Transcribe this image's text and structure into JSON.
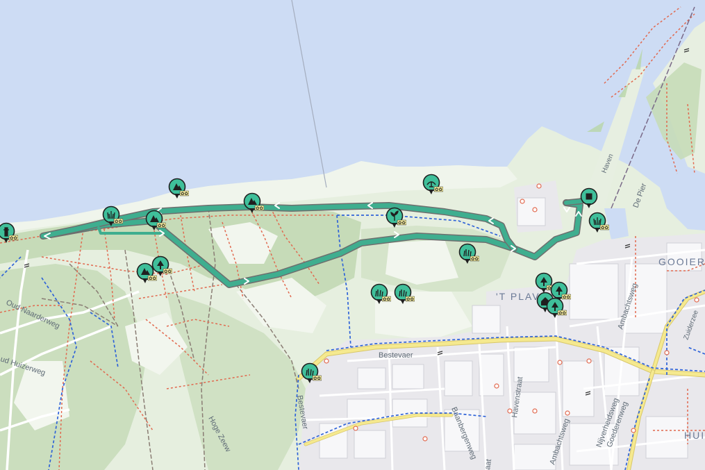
{
  "map": {
    "colors": {
      "water": "#cddcf4",
      "forest": "#c9dcbc",
      "grass": "#e6f0df",
      "urban": "#e7e7ea",
      "route": "#3fae8f",
      "route_outline": "#6e6e6e",
      "footpath": "#e1694f",
      "cycle_path": "#2f63d8",
      "main_road": "#f3e38b",
      "poi": "#3fbf9a"
    },
    "labels": {
      "oud_naarderweg": "Oud Naarderweg",
      "oud_huizerweg": "ud Huizerweg",
      "hoge_zeeweg": "Hoge Zeew",
      "bestevaer_top": "Bestevaer",
      "bestevaer_side": "Bestevaer",
      "baanbergenweg": "Baanbergenweg",
      "havenstraat": "Havenstraat",
      "ambachtsweg_a": "Ambachtsweg",
      "ambachtsweg_b": "Ambachtsweg",
      "nijverheidsweg": "Nijverheidsweg",
      "goederenweg": "Goederenweg",
      "de_pier": "De Pier",
      "haven": "Haven",
      "zuiderzee": "Zuiderzee",
      "oud_haven": "aat",
      "place_plaveen": "'T PLAV",
      "place_gooierhaven": "GOOIERH",
      "place_hui": "HUI"
    },
    "pois": [
      {
        "name": "forest-poi",
        "icon": "trees"
      },
      {
        "name": "forest-poi",
        "icon": "trees"
      },
      {
        "name": "marsh-poi",
        "icon": "reed"
      },
      {
        "name": "forest-poi",
        "icon": "trees"
      },
      {
        "name": "forest-poi",
        "icon": "trees"
      },
      {
        "name": "forest-poi",
        "icon": "trees"
      },
      {
        "name": "bird-poi",
        "icon": "bird"
      },
      {
        "name": "plant-poi",
        "icon": "plant"
      },
      {
        "name": "meadow-poi",
        "icon": "grass"
      },
      {
        "name": "meadow-poi",
        "icon": "grass"
      },
      {
        "name": "meadow-poi",
        "icon": "grass"
      },
      {
        "name": "meadow-poi",
        "icon": "grass"
      },
      {
        "name": "start-poi",
        "icon": "square"
      },
      {
        "name": "marsh-poi",
        "icon": "reed"
      },
      {
        "name": "tree-poi",
        "icon": "tree"
      },
      {
        "name": "house-poi",
        "icon": "house"
      },
      {
        "name": "tree-poi",
        "icon": "tree"
      },
      {
        "name": "edge-poi",
        "icon": "tower"
      }
    ]
  }
}
